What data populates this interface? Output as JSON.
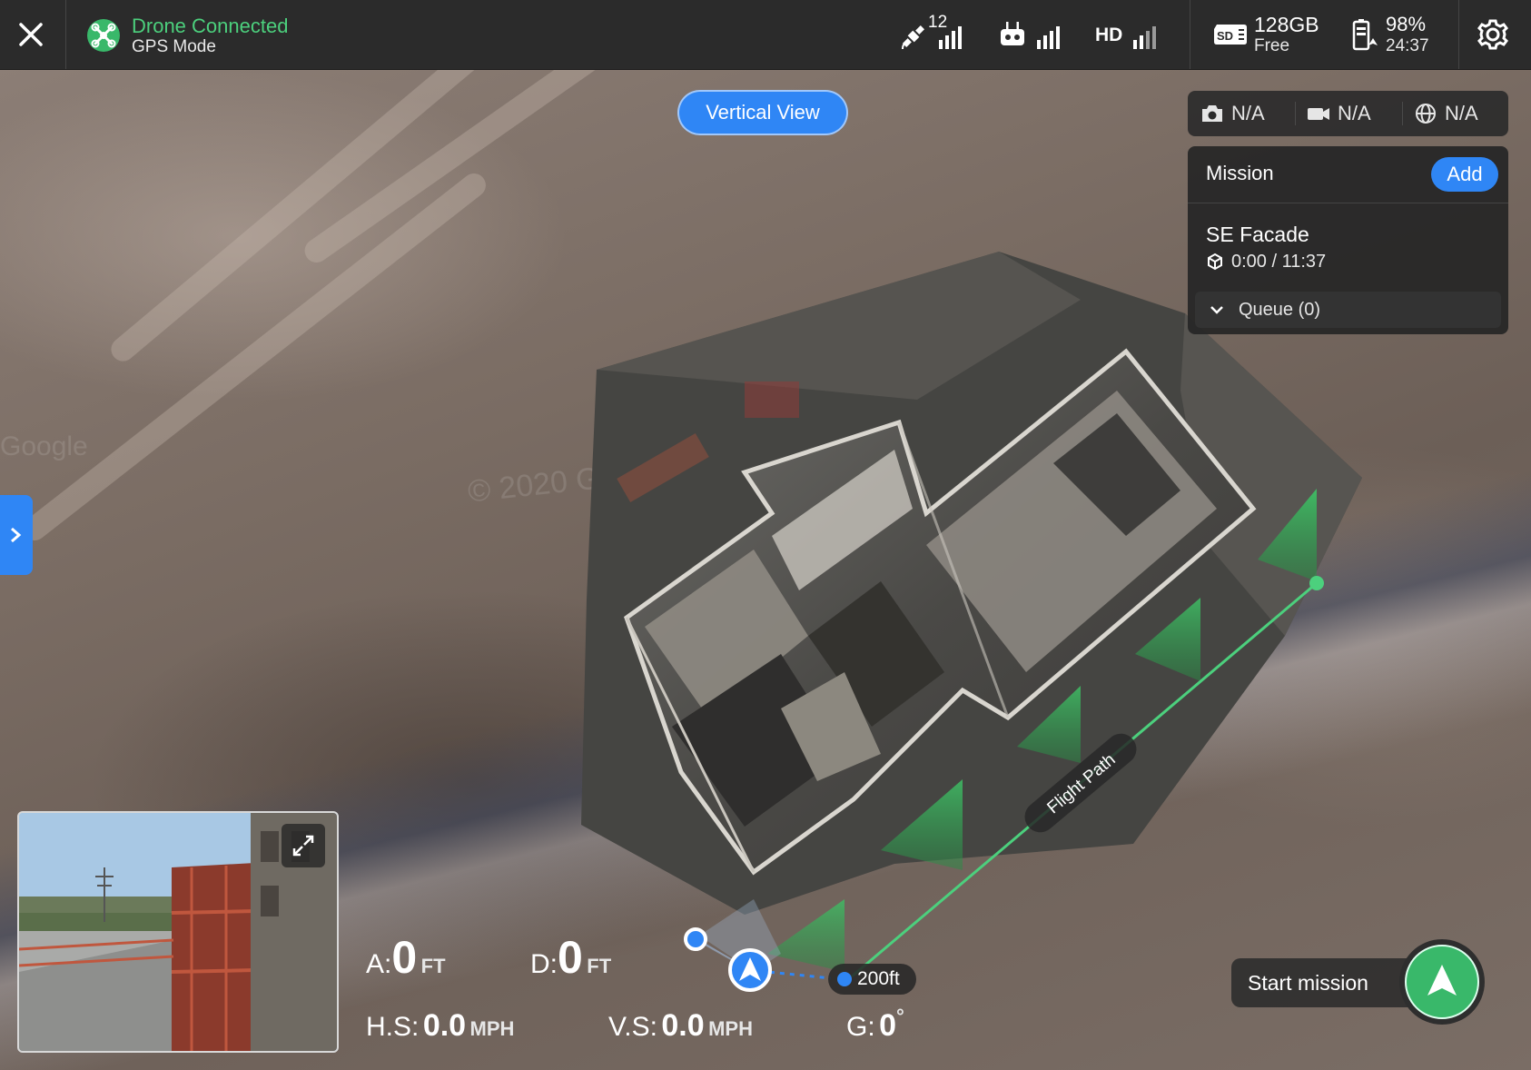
{
  "topbar": {
    "close_icon": "close-icon",
    "drone_icon": "drone-connected-icon",
    "drone_status": "Drone Connected",
    "flight_mode": "GPS Mode",
    "satellite_count": "12",
    "hd_label": "HD",
    "sd_label": "SD",
    "storage_value": "128GB",
    "storage_sub": "Free",
    "battery_percent": "98%",
    "battery_time": "24:37",
    "settings_icon": "gear-icon"
  },
  "map": {
    "view_toggle": "Vertical View",
    "flight_path_label": "Flight Path",
    "altitude_tag": "200ft",
    "watermark": "© 2020 G",
    "watermark2": "Google"
  },
  "media": {
    "photo": "N/A",
    "video": "N/A",
    "globe": "N/A"
  },
  "mission": {
    "title": "Mission",
    "add_label": "Add",
    "name": "SE Facade",
    "time": "0:00 / 11:37",
    "queue_label": "Queue (0)"
  },
  "telemetry": {
    "a_label": "A:",
    "a_value": "0",
    "a_unit": "FT",
    "d_label": "D:",
    "d_value": "0",
    "d_unit": "FT",
    "hs_label": "H.S:",
    "hs_value": "0.0",
    "hs_unit": "MPH",
    "vs_label": "V.S:",
    "vs_value": "0.0",
    "vs_unit": "MPH",
    "g_label": "G:",
    "g_value": "0",
    "g_unit": "°"
  },
  "start": {
    "label": "Start mission"
  },
  "colors": {
    "accent_blue": "#2f86f5",
    "success_green": "#4cd07d",
    "start_green": "#39b86a",
    "bar_bg": "#2b2b2b"
  }
}
